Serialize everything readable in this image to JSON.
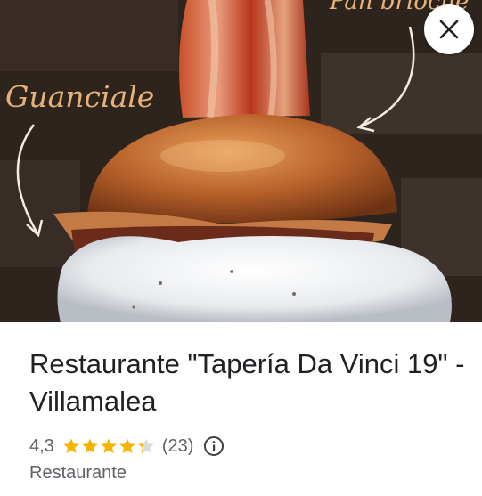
{
  "hero": {
    "photo_label_left": "Guanciale",
    "photo_label_top_right": "Pan brioche"
  },
  "place": {
    "name": "Restaurante \"Tapería Da Vinci 19\" - Villamalea",
    "rating": "4,3",
    "rating_value": 4.3,
    "stars_total": 5,
    "review_count": "(23)",
    "category": "Restaurante"
  },
  "icons": {
    "close": "close-icon",
    "star": "star-icon",
    "info": "info-icon"
  },
  "colors": {
    "star": "#f4b400",
    "star_empty": "#dadce0",
    "title": "#202124",
    "secondary_text": "#5f6368"
  }
}
